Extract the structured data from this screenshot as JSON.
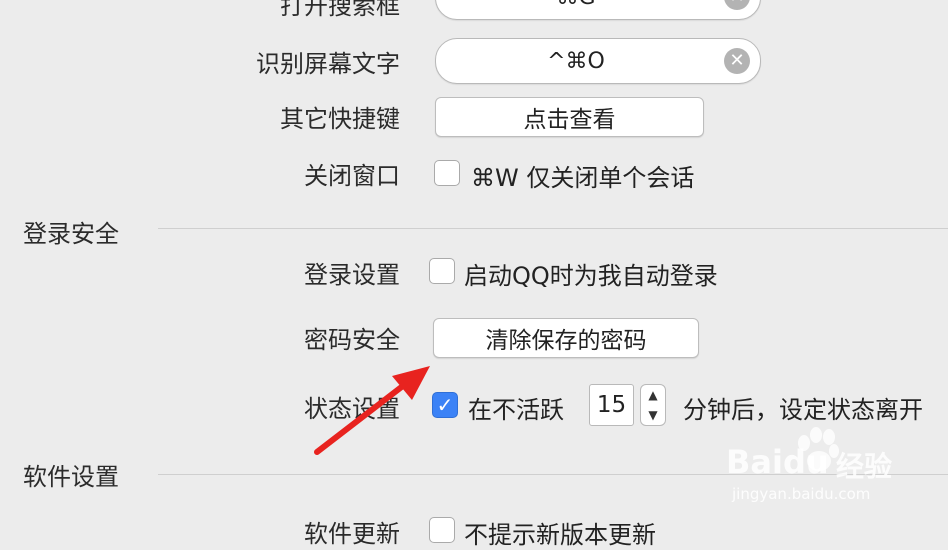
{
  "shortcuts": {
    "open_search": {
      "label": "打开搜索框",
      "value": "⌘G"
    },
    "recognize_text": {
      "label": "识别屏幕文字",
      "value": "^⌘O"
    },
    "other_shortcuts": {
      "label": "其它快捷键",
      "button": "点击查看"
    },
    "close_window": {
      "label": "关闭窗口",
      "option": "⌘W 仅关闭单个会话",
      "checked": false
    }
  },
  "login_security": {
    "title": "登录安全",
    "login_settings": {
      "label": "登录设置",
      "option": "启动QQ时为我自动登录",
      "checked": false
    },
    "password_security": {
      "label": "密码安全",
      "button": "清除保存的密码"
    },
    "status_settings": {
      "label": "状态设置",
      "checked": true,
      "prefix": "在不活跃",
      "minutes": "15",
      "suffix": "分钟后，设定状态离开"
    }
  },
  "software_settings": {
    "title": "软件设置",
    "software_update": {
      "label": "软件更新",
      "option": "不提示新版本更新",
      "checked": false
    }
  },
  "watermark": {
    "brand": "Baidu",
    "brand_cn": "经验",
    "url": "jingyan.baidu.com"
  },
  "colors": {
    "accent": "#3b82f6",
    "arrow": "#e8231f",
    "background": "#ececec"
  }
}
